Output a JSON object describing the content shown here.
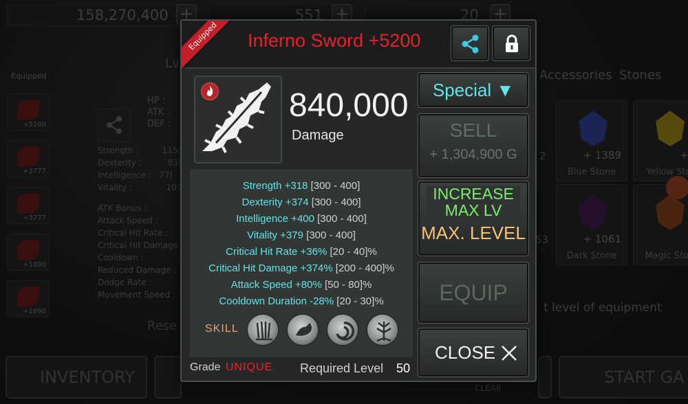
{
  "background": {
    "gold": "158,270,400",
    "gems": "551",
    "keys": "20",
    "plus": "+",
    "equipped_label": "Equipped",
    "slot_levels": [
      "+5200",
      "+3777",
      "+3777",
      "+1090",
      "+1090"
    ],
    "lv_label": "Lv",
    "hp_lines": [
      "HP :",
      "ATK :",
      "DEF :"
    ],
    "stats": [
      "Strength :",
      "Dexterity :",
      "Intelligence :",
      "Vitality :"
    ],
    "stat_vals": [
      "115(",
      "83(",
      "77(",
      "107("
    ],
    "extra_stats": [
      "ATK Bonus :",
      "Attack Speed :",
      "Critical Hit Rate :",
      "Critical Hit Damage :",
      "Cooldown :",
      "Reduced Damage :",
      "Dodge Rate :",
      "Movement Speed :"
    ],
    "reset": "Rese",
    "tabs": [
      "Accessories",
      "Stones"
    ],
    "stones": [
      {
        "count": "+ 1389",
        "name": "Blue Stone",
        "color": "#2a3a8a"
      },
      {
        "count": "+ 3",
        "name": "Yellow Sto",
        "color": "#8a7a1a"
      },
      {
        "count": "+ 1061",
        "name": "Dark Stone",
        "color": "#3a1a4a"
      },
      {
        "count": "",
        "name": "Magic Stor",
        "color": "#7a3a1a"
      }
    ],
    "partial_counts": [
      "2",
      "53"
    ],
    "hint": "t level of equipment",
    "inventory": "INVENTORY",
    "start": "START GA",
    "clear": "CLEAR"
  },
  "dialog": {
    "ribbon": "Equipped",
    "title": "Inferno Sword +5200",
    "damage_value": "840,000",
    "damage_label": "Damage",
    "stats": [
      {
        "name": "Strength +318",
        "range": "[300 - 400]"
      },
      {
        "name": "Dexterity +374",
        "range": "[300 - 400]"
      },
      {
        "name": "Intelligence +400",
        "range": "[300 - 400]"
      },
      {
        "name": "Vitality +379",
        "range": "[300 - 400]"
      },
      {
        "name": "Critical Hit Rate +36%",
        "range": "[20 - 40]%"
      },
      {
        "name": "Critical Hit Damage +374%",
        "range": "[200 - 400]%"
      },
      {
        "name": "Attack Speed +80%",
        "range": "[50 - 80]%"
      },
      {
        "name": "Cooldown Duration -28%",
        "range": "[20 - 30]%"
      }
    ],
    "skill_label": "SKILL",
    "skills": [
      "sword-rain-skill-icon",
      "strength-arm-skill-icon",
      "swirl-skill-icon",
      "tree-roots-skill-icon"
    ],
    "grade_label": "Grade",
    "grade_value": "UNIQUE",
    "required_label": "Required Level",
    "required_value": "50",
    "special_label": "Special ▼",
    "sell_label": "SELL",
    "sell_price": "+ 1,304,900 G",
    "increase_label": "INCREASE MAX LV",
    "max_level_label": "MAX. LEVEL",
    "equip_label": "EQUIP",
    "close_label": "CLOSE",
    "colors": {
      "title": "#e8202a",
      "stat": "#5fe6ea",
      "special": "#5fe6ea",
      "increase": "#7ff06a",
      "max_level": "#f7c274",
      "skill": "#f0a070"
    }
  }
}
